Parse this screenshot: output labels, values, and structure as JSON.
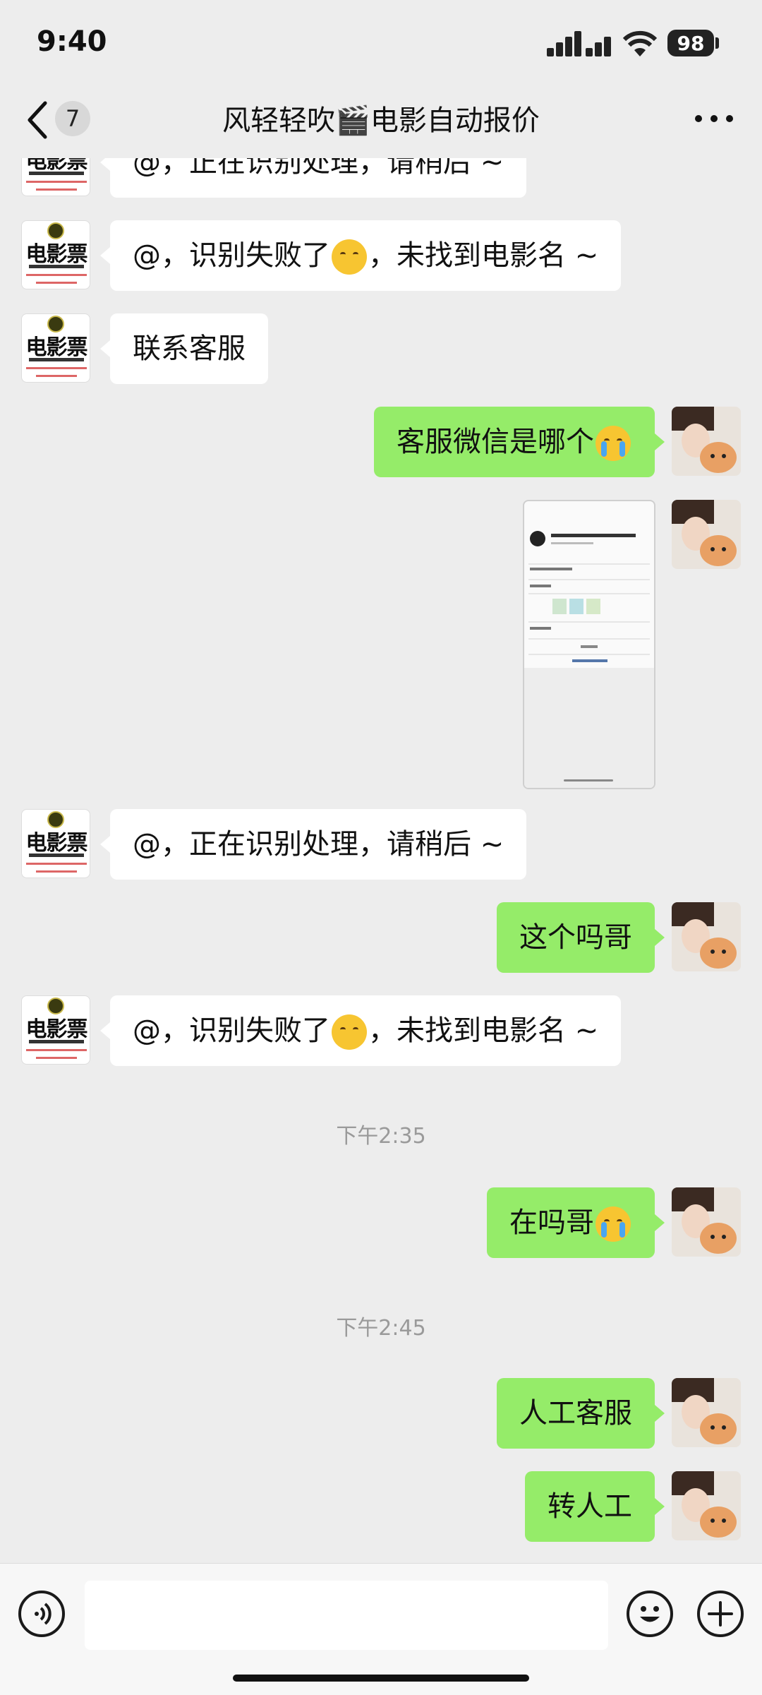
{
  "status_bar": {
    "time": "9:40",
    "battery": "98"
  },
  "nav": {
    "unread_count": "7",
    "title": "风轻轻吹🎬电影自动报价"
  },
  "avatar_left": {
    "title": "电影票"
  },
  "messages": [
    {
      "side": "left",
      "text_before": "@，正在识别处理，请稍后 ~"
    },
    {
      "side": "left",
      "text_before": "@，识别失败了",
      "emoji": "pouting-face-emoji",
      "text_after": "，未找到电影名 ~"
    },
    {
      "side": "left",
      "text_before": "联系客服"
    },
    {
      "side": "right",
      "text_before": "客服微信是哪个",
      "emoji": "loudly-crying-face-emoji"
    },
    {
      "side": "right",
      "type": "image"
    },
    {
      "side": "left",
      "text_before": "@，正在识别处理，请稍后 ~"
    },
    {
      "side": "right",
      "text_before": "这个吗哥"
    },
    {
      "side": "left",
      "text_before": "@，识别失败了",
      "emoji": "pouting-face-emoji",
      "text_after": "，未找到电影名 ~"
    },
    {
      "side": "right",
      "text_before": "在吗哥",
      "emoji": "loudly-crying-face-emoji"
    },
    {
      "side": "right",
      "text_before": "人工客服"
    },
    {
      "side": "right",
      "text_before": "转人工"
    }
  ],
  "timestamps": [
    "下午2:35",
    "下午2:45"
  ],
  "icons": {
    "back": "chevron-left-icon",
    "more": "more-dots-icon",
    "voice": "voice-icon",
    "emoji": "emoji-icon",
    "plus": "plus-icon"
  },
  "colors": {
    "outgoing_bubble": "#95ec69",
    "incoming_bubble": "#ffffff",
    "background": "#ededed"
  }
}
